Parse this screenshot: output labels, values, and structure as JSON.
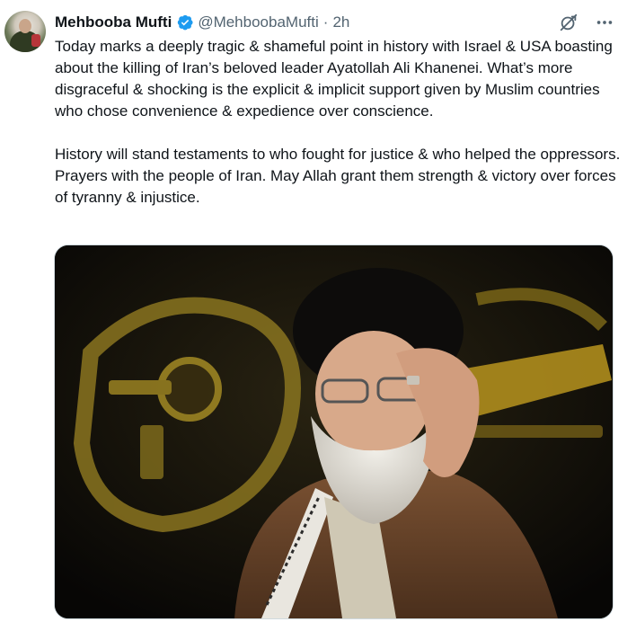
{
  "author": {
    "name": "Mehbooba Mufti",
    "handle": "@MehboobaMufti",
    "separator": "·",
    "time": "2h",
    "verified": true,
    "avatar_icon": "profile-photo"
  },
  "tweet": {
    "paragraph_1": "Today marks a deeply tragic & shameful point in history with Israel & USA boasting about the killing of Iran’s beloved leader Ayatollah Ali Khanenei. What’s more disgraceful & shocking is the explicit & implicit support given by Muslim countries who chose convenience & expedience over conscience.",
    "paragraph_2": "History will stand testaments to who fought for justice & who helped the oppressors. Prayers with the people of Iran. May Allah grant them strength & victory over forces of tyranny & injustice."
  },
  "actions": {
    "grok_icon": "grok-icon",
    "more_icon": "more-options-icon"
  },
  "colors": {
    "text_primary": "#0f1419",
    "text_secondary": "#536471",
    "verified_blue": "#1d9bf0",
    "media_border": "#cfd9de"
  }
}
